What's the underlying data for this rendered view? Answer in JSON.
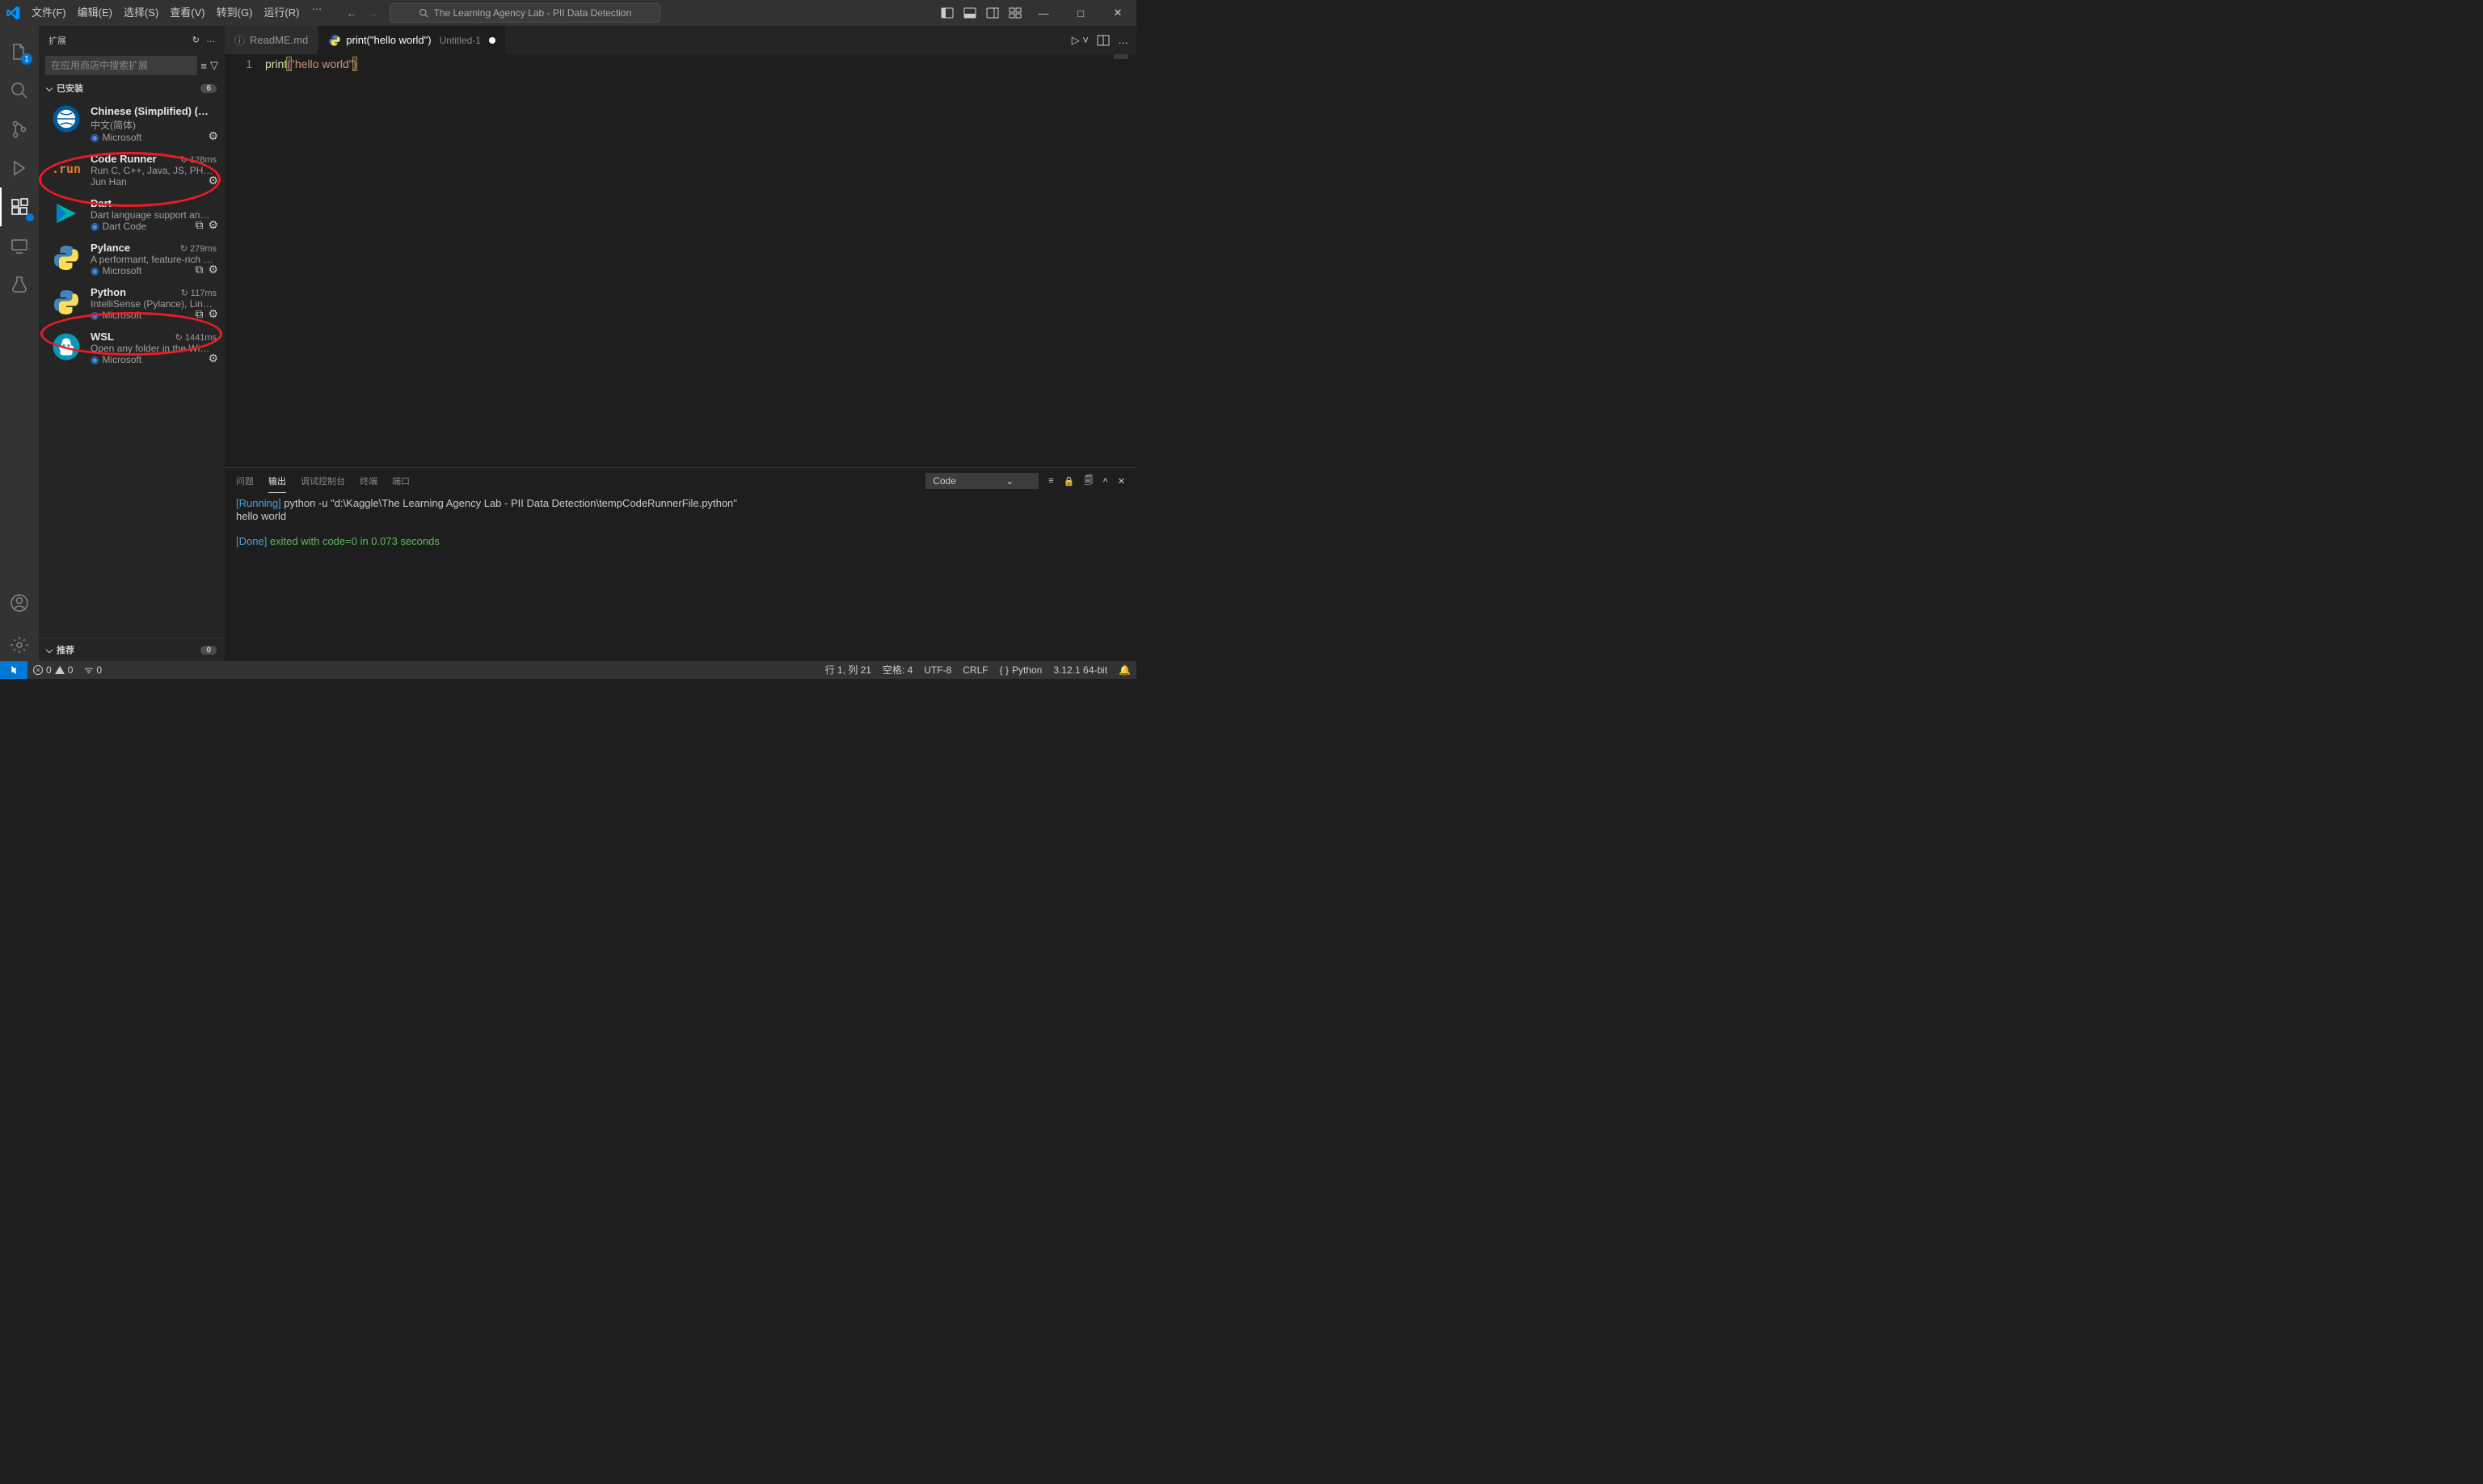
{
  "menu": {
    "file": "文件(F)",
    "edit": "编辑(E)",
    "select": "选择(S)",
    "view": "查看(V)",
    "goto": "转到(G)",
    "run": "运行(R)"
  },
  "search_placeholder": "The Learning Agency Lab - PII Data Detection",
  "sidebar": {
    "title": "扩展",
    "search_placeholder": "在应用商店中搜索扩展",
    "installed_label": "已安装",
    "installed_count": "6",
    "recommend_label": "推荐",
    "recommend_count": "0"
  },
  "extensions": [
    {
      "name": "Chinese (Simplified) (简体…",
      "desc": "中文(简体)",
      "pub": "Microsoft",
      "verified": true,
      "time": "",
      "gear": true,
      "switch": false
    },
    {
      "name": "Code Runner",
      "desc": "Run C, C++, Java, JS, PHP, P…",
      "pub": "Jun Han",
      "verified": false,
      "time": "128ms",
      "gear": true,
      "switch": false
    },
    {
      "name": "Dart",
      "desc": "Dart language support and …",
      "pub": "Dart Code",
      "verified": true,
      "time": "",
      "gear": true,
      "switch": true
    },
    {
      "name": "Pylance",
      "desc": "A performant, feature-rich l…",
      "pub": "Microsoft",
      "verified": true,
      "time": "279ms",
      "gear": true,
      "switch": true
    },
    {
      "name": "Python",
      "desc": "IntelliSense (Pylance), Lintin…",
      "pub": "Microsoft",
      "verified": true,
      "time": "117ms",
      "gear": true,
      "switch": true
    },
    {
      "name": "WSL",
      "desc": "Open any folder in the Win…",
      "pub": "Microsoft",
      "verified": true,
      "time": "1441ms",
      "gear": true,
      "switch": false
    }
  ],
  "tabs": {
    "readme": "ReadME.md",
    "active_title": "print(\"hello world\")",
    "active_desc": "Untitled-1"
  },
  "code": {
    "lineno": "1",
    "fn": "print",
    "lp": "(",
    "str": "\"hello world\"",
    "rp": ")"
  },
  "panel": {
    "problems": "问题",
    "output": "输出",
    "debug": "调试控制台",
    "terminal": "终端",
    "ports": "端口",
    "select": "Code",
    "out_running": "[Running]",
    "out_cmd": " python -u \"d:\\Kaggle\\The Learning Agency Lab - PII Data Detection\\tempCodeRunnerFile.python\"",
    "out_hello": "hello world",
    "out_done": "[Done]",
    "out_done_rest": " exited with code=0 in 0.073 seconds"
  },
  "status": {
    "errors": "0",
    "warnings": "0",
    "ports": "0",
    "lncol": "行 1, 列 21",
    "spaces": "空格: 4",
    "encoding": "UTF-8",
    "eol": "CRLF",
    "lang": "Python",
    "interp": "3.12.1 64-bit"
  }
}
